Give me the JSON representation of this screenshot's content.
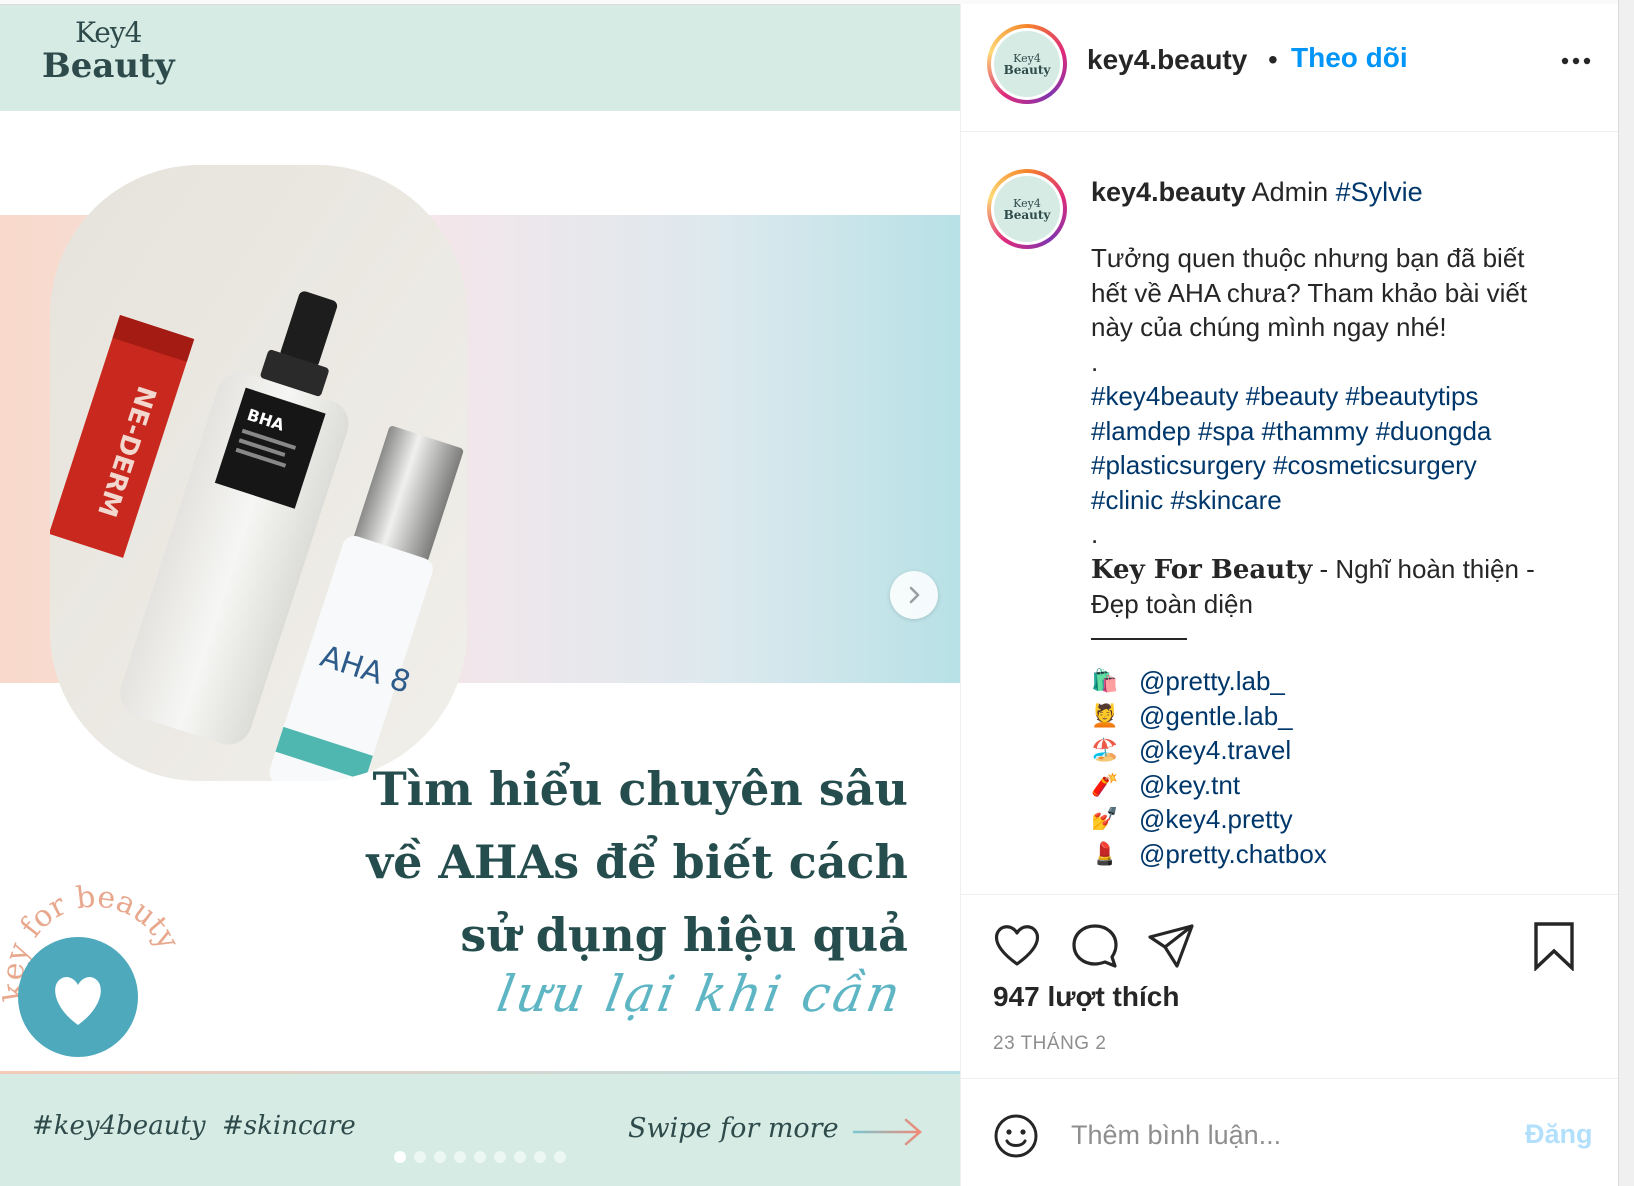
{
  "post_image": {
    "logo_line1": "Key4",
    "logo_line2": "Beauty",
    "headline_lines": [
      "Tìm hiểu chuyên sâu",
      "về AHAs để biết cách",
      "sử dụng hiệu quả"
    ],
    "script_text": "lưu lại khi cần",
    "badge_text": "key for beauty",
    "bottom_tags": [
      "#key4beauty",
      "#skincare"
    ],
    "swipe_text": "Swipe for more",
    "product_labels": {
      "tube": "NE-DERM",
      "bottle": "BHA",
      "serum": "AHA 8"
    },
    "carousel": {
      "total_slides": 9,
      "active_index": 0
    },
    "colors": {
      "band": "#d5ebe4",
      "teal": "#5eb6c4",
      "heading": "#264d4d"
    }
  },
  "header": {
    "username": "key4.beauty",
    "separator": "•",
    "follow_label": "Theo dõi",
    "avatar_text1": "Key4",
    "avatar_text2": "Beauty"
  },
  "caption": {
    "username": "key4.beauty",
    "author_note": "Admin",
    "author_tag": "#Sylvie",
    "intro_lines": [
      "Tưởng quen thuộc nhưng bạn đã biết",
      "hết về AHA chưa? Tham khảo bài viết",
      "này của chúng mình ngay nhé!"
    ],
    "dot1": ".",
    "hashtag_lines": [
      "#key4beauty #beauty #beautytips",
      "#lamdep #spa #thammy #duongda",
      "#plasticsurgery #cosmeticsurgery",
      "#clinic #skincare"
    ],
    "dot2": ".",
    "brand_name": "Key For Beauty",
    "slogan_part1": " - Nghĩ hoàn thiện -",
    "slogan_part2": "Đẹp toàn diện",
    "mentions": [
      {
        "emoji": "🛍️",
        "handle": "@pretty.lab_"
      },
      {
        "emoji": "💆",
        "handle": "@gentle.lab_"
      },
      {
        "emoji": "🏖️",
        "handle": "@key4.travel"
      },
      {
        "emoji": "🧨",
        "handle": "@key.tnt"
      },
      {
        "emoji": "💅",
        "handle": "@key4.pretty"
      },
      {
        "emoji": "💄",
        "handle": "@pretty.chatbox"
      }
    ]
  },
  "actions": {
    "likes": "947 lượt thích",
    "date": "23 THÁNG 2"
  },
  "comment": {
    "placeholder": "Thêm bình luận...",
    "post_label": "Đăng"
  }
}
